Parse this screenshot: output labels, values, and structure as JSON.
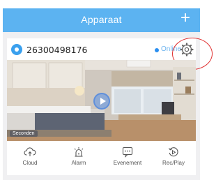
{
  "header": {
    "title": "Apparaat",
    "add_label": "+"
  },
  "device": {
    "id": "26300498176",
    "status": "Online",
    "camera_label": "Seconden"
  },
  "actions": [
    {
      "label": "Cloud",
      "icon": "cloud-upload-icon"
    },
    {
      "label": "Alarm",
      "icon": "alarm-icon"
    },
    {
      "label": "Evenement",
      "icon": "event-message-icon"
    },
    {
      "label": "Rec/Play",
      "icon": "replay-icon"
    }
  ],
  "colors": {
    "header": "#5cb3f1",
    "accent": "#3aa0ee",
    "highlight": "#e03030"
  }
}
